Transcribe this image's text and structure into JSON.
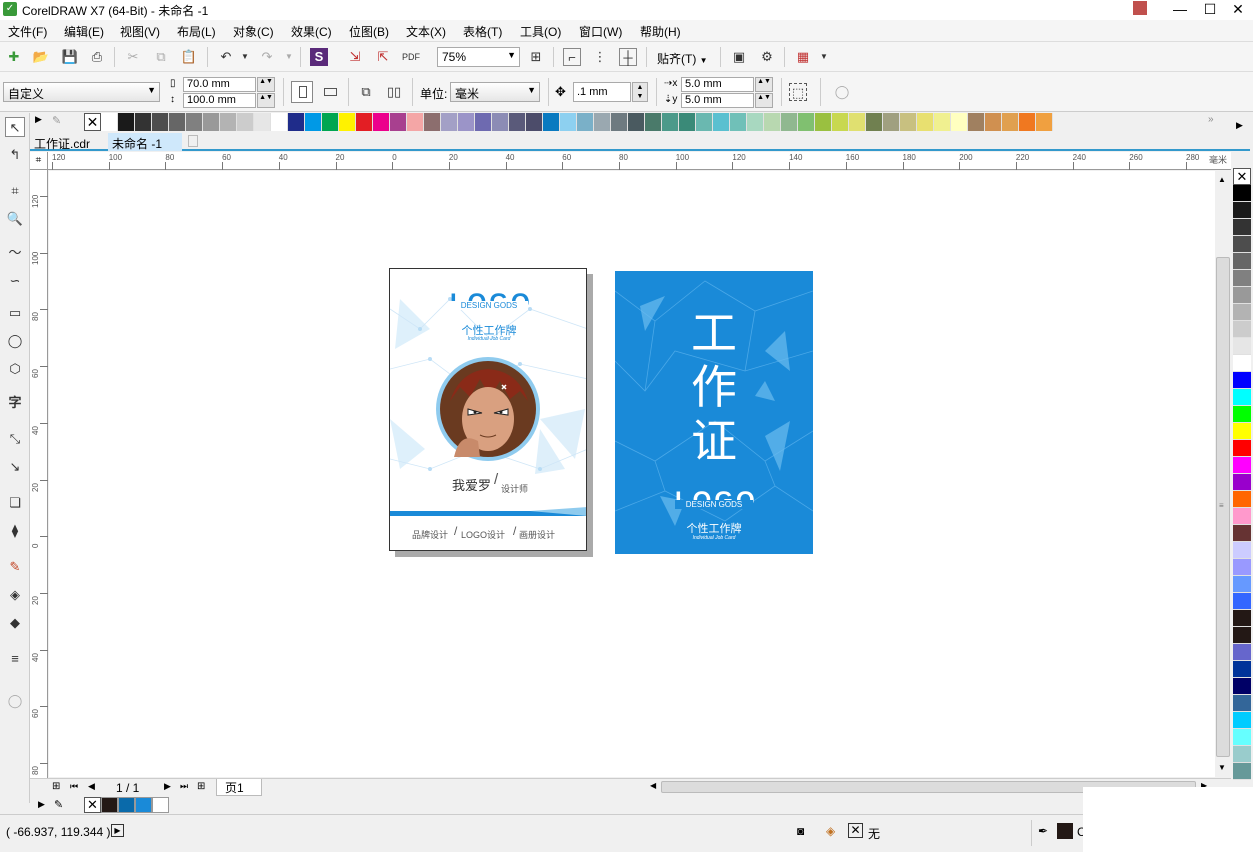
{
  "window": {
    "title": "CorelDRAW X7 (64-Bit) - 未命名 -1"
  },
  "menu": [
    "文件(F)",
    "编辑(E)",
    "视图(V)",
    "布局(L)",
    "对象(C)",
    "效果(C)",
    "位图(B)",
    "文本(X)",
    "表格(T)",
    "工具(O)",
    "窗口(W)",
    "帮助(H)"
  ],
  "toolbar": {
    "zoom": "75%",
    "snap_label": "贴齐(T)"
  },
  "propbar": {
    "page_preset": "自定义",
    "width": "70.0 mm",
    "height": "100.0 mm",
    "units_label": "单位:",
    "units_value": "毫米",
    "nudge": ".1 mm",
    "dup_x": "5.0 mm",
    "dup_y": "5.0 mm"
  },
  "tabs": [
    "工作证.cdr",
    "未命名 -1"
  ],
  "ruler": {
    "unit": "毫米",
    "h_ticks": [
      "120",
      "100",
      "80",
      "60",
      "40",
      "20",
      "0",
      "20",
      "40",
      "60",
      "80",
      "100",
      "120",
      "140",
      "160",
      "180",
      "200",
      "220",
      "240",
      "260",
      "280"
    ],
    "v_ticks": [
      "120",
      "100",
      "80",
      "60",
      "40",
      "20",
      "0",
      "20",
      "40",
      "60",
      "80"
    ]
  },
  "card_front": {
    "logo": "LOGO",
    "logo_sub": "DESIGN GODS",
    "title": "个性工作牌",
    "subtitle": "Individual Job Card",
    "name": "我爱罗",
    "role": "设计师",
    "footer": [
      "品牌设计",
      "LOGO设计",
      "画册设计"
    ]
  },
  "card_back": {
    "title_chars": [
      "工",
      "作",
      "证"
    ],
    "logo": "LOGO",
    "logo_sub": "DESIGN GODS",
    "title": "个性工作牌",
    "subtitle": "Individual Job Card"
  },
  "pagebar": {
    "page_count": "1 / 1",
    "page_tab": "页1"
  },
  "status": {
    "coords": "( -66.937, 119.344 )",
    "fill_label": "无",
    "outline_label": "C"
  },
  "colors": {
    "accent_blue": "#1a8ad8",
    "light_blue": "#8fcbee",
    "top_palette": [
      "#ffffff",
      "#1a1a1a",
      "#333333",
      "#4d4d4d",
      "#666666",
      "#808080",
      "#999999",
      "#b3b3b3",
      "#cccccc",
      "#e6e6e6",
      "#ffffff",
      "#1f2c8a",
      "#0099e6",
      "#00a651",
      "#fff200",
      "#e31e24",
      "#ec008c",
      "#a8408f",
      "#f4a6a6",
      "#8c6e6e",
      "#a3a0c6",
      "#9b94c8",
      "#6e6ab0",
      "#8c8cb5",
      "#5a5a7a",
      "#4c4c6a",
      "#0a7ac0",
      "#8dd0f0",
      "#7ab0c8",
      "#9aa8b0",
      "#6e7a80",
      "#4a5a60",
      "#4a7a6a",
      "#4c9a8a",
      "#3a8a78",
      "#6ab8b0",
      "#5ac0d0",
      "#70c0b8",
      "#a8d8c0",
      "#b8d8b0",
      "#90b890",
      "#80c070",
      "#9ac040",
      "#c8d850",
      "#e0e070",
      "#708050",
      "#a0a080",
      "#c8c080",
      "#e8e070",
      "#f0f090",
      "#ffffc0",
      "#a08060",
      "#d09050",
      "#e0a050",
      "#f07820",
      "#f0a040"
    ],
    "right_palette": [
      "#000000",
      "#1a1a1a",
      "#333333",
      "#4d4d4d",
      "#666666",
      "#808080",
      "#999999",
      "#b3b3b3",
      "#cccccc",
      "#e6e6e6",
      "#ffffff",
      "#0000ff",
      "#00ffff",
      "#00ff00",
      "#ffff00",
      "#ff0000",
      "#ff00ff",
      "#9900cc",
      "#ff6600",
      "#ff99cc",
      "#663333",
      "#ccccff",
      "#9999ff",
      "#6699ff",
      "#3366ff",
      "#231815",
      "#231815",
      "#6666cc",
      "#003399",
      "#000066",
      "#336699",
      "#00ccff",
      "#66ffff",
      "#99cccc",
      "#669999"
    ],
    "doc_palette": [
      "#231815",
      "#0a6aaa",
      "#1a8ad8",
      "#ffffff"
    ]
  }
}
